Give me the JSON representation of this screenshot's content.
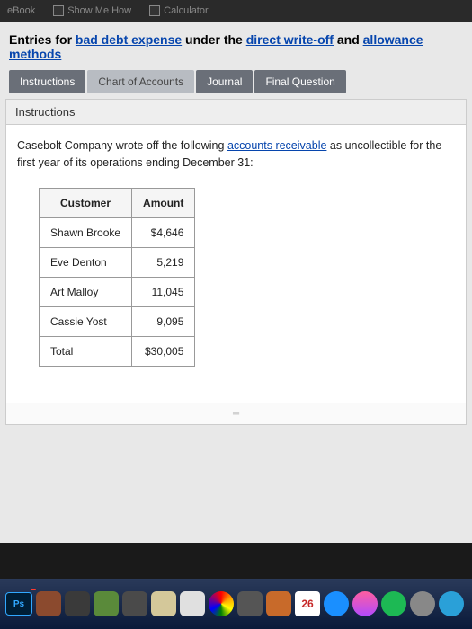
{
  "topBar": {
    "ebook": "eBook",
    "showMeHow": "Show Me How",
    "calculator": "Calculator"
  },
  "title": {
    "prefix": "Entries for ",
    "link1": "bad debt expense",
    "mid": " under the ",
    "link2": "direct write-off",
    "mid2": " and ",
    "link3": "allowance methods"
  },
  "tabs": {
    "instructions": "Instructions",
    "chartOfAccounts": "Chart of Accounts",
    "journal": "Journal",
    "finalQuestion": "Final Question"
  },
  "panel": {
    "header": "Instructions",
    "text1": "Casebolt Company wrote off the following ",
    "linkAR": "accounts receivable",
    "text2": " as uncollectible for the first year of its operations ending December 31:"
  },
  "table": {
    "headers": {
      "customer": "Customer",
      "amount": "Amount"
    },
    "rows": [
      {
        "customer": "Shawn Brooke",
        "amount": "$4,646"
      },
      {
        "customer": "Eve Denton",
        "amount": "5,219"
      },
      {
        "customer": "Art Malloy",
        "amount": "11,045"
      },
      {
        "customer": "Cassie Yost",
        "amount": "9,095"
      },
      {
        "customer": "Total",
        "amount": "$30,005"
      }
    ]
  },
  "dock": {
    "ps": "Ps",
    "calendarDay": "26"
  }
}
